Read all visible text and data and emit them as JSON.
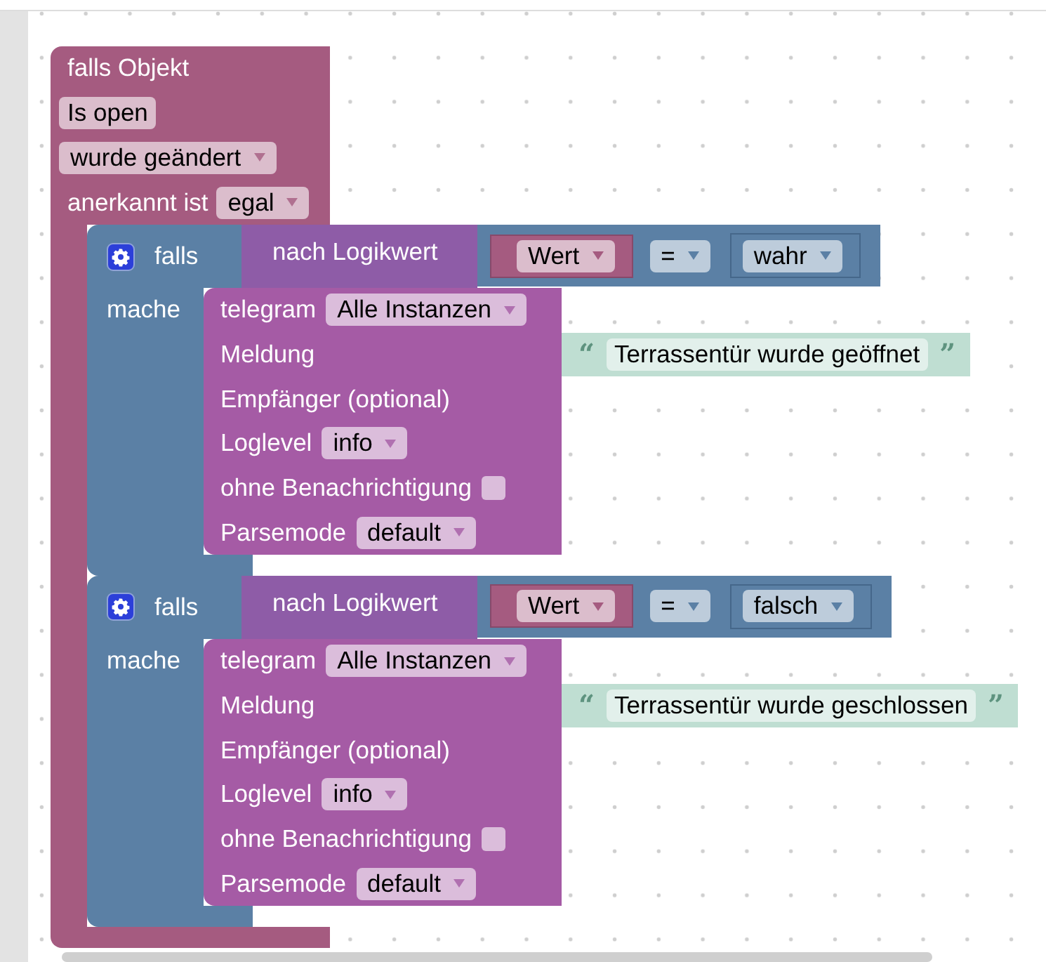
{
  "event_block": {
    "title": "falls Objekt",
    "object": "Is open",
    "trigger": "wurde geändert",
    "ack_label": "anerkannt ist",
    "ack": "egal",
    "if_blocks": [
      {
        "keyword": "falls",
        "condition": {
          "label": "nach Logikwert",
          "left": "Wert",
          "operator": "=",
          "right": "wahr"
        },
        "do_label": "mache",
        "telegram": {
          "title": "telegram",
          "instance": "Alle Instanzen",
          "message_label": "Meldung",
          "quote_open": "“",
          "message": "Terrassentür wurde geöffnet",
          "quote_close": "”",
          "recipient_label": "Empfänger (optional)",
          "loglevel_label": "Loglevel",
          "loglevel": "info",
          "silent_label": "ohne Benachrichtigung",
          "silent_checked": false,
          "parsemode_label": "Parsemode",
          "parsemode": "default"
        }
      },
      {
        "keyword": "falls",
        "condition": {
          "label": "nach Logikwert",
          "left": "Wert",
          "operator": "=",
          "right": "falsch"
        },
        "do_label": "mache",
        "telegram": {
          "title": "telegram",
          "instance": "Alle Instanzen",
          "message_label": "Meldung",
          "quote_open": "“",
          "message": "Terrassentür wurde geschlossen",
          "quote_close": "”",
          "recipient_label": "Empfänger (optional)",
          "loglevel_label": "Loglevel",
          "loglevel": "info",
          "silent_label": "ohne Benachrichtigung",
          "silent_checked": false,
          "parsemode_label": "Parsemode",
          "parsemode": "default"
        }
      }
    ]
  }
}
